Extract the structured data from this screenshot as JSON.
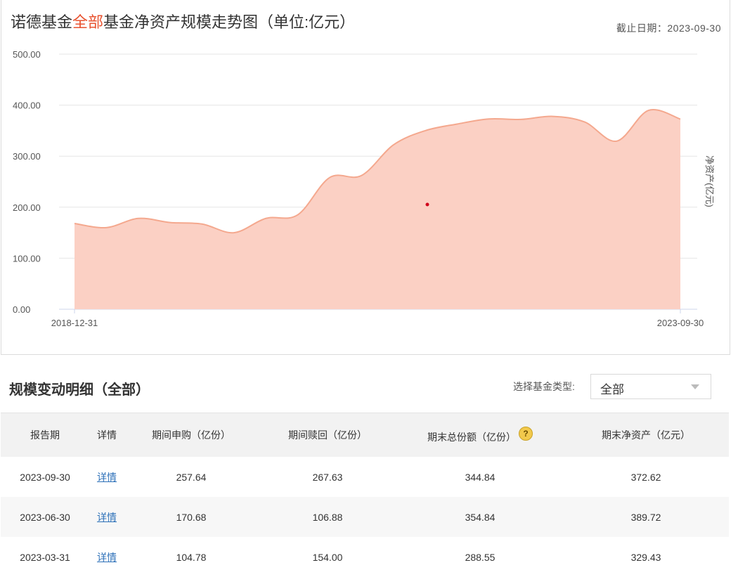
{
  "chart_header": {
    "title_prefix": "诺德基金",
    "title_highlight": "全部",
    "title_suffix": "基金净资产规模走势图（单位:亿元）",
    "as_of": "截止日期：2023-09-30"
  },
  "chart_data": {
    "type": "area",
    "ylabel": "净资产(亿元)",
    "ylim": [
      0,
      500
    ],
    "yticks": [
      "0.00",
      "100.00",
      "200.00",
      "300.00",
      "400.00",
      "500.00"
    ],
    "x_ticks": [
      "2018-12-31",
      "2023-09-30"
    ],
    "x": [
      "2018-12-31",
      "2019-03-31",
      "2019-06-30",
      "2019-09-30",
      "2019-12-31",
      "2020-03-31",
      "2020-06-30",
      "2020-09-30",
      "2020-12-31",
      "2021-03-31",
      "2021-06-30",
      "2021-09-30",
      "2021-12-31",
      "2022-03-31",
      "2022-06-30",
      "2022-09-30",
      "2022-12-31",
      "2023-03-31",
      "2023-06-30",
      "2023-09-30"
    ],
    "values": [
      168,
      160,
      178,
      170,
      167,
      150,
      178,
      185,
      258,
      262,
      322,
      350,
      363,
      373,
      372,
      378,
      367,
      329.43,
      389.72,
      372.62
    ],
    "grid": true,
    "fill_color": "#fbd0c4",
    "line_color": "#f4a88e"
  },
  "detail": {
    "section_title": "规模变动明细（全部）",
    "fund_type_label": "选择基金类型:",
    "fund_type_value": "全部",
    "headers": [
      "报告期",
      "详情",
      "期间申购（亿份）",
      "期间赎回（亿份）",
      "期末总份额（亿份）",
      "期末净资产（亿元）"
    ],
    "rows": [
      {
        "date": "2023-09-30",
        "detail": "详情",
        "purchase": "257.64",
        "redeem": "267.63",
        "shares": "344.84",
        "nav": "372.62"
      },
      {
        "date": "2023-06-30",
        "detail": "详情",
        "purchase": "170.68",
        "redeem": "106.88",
        "shares": "354.84",
        "nav": "389.72"
      },
      {
        "date": "2023-03-31",
        "detail": "详情",
        "purchase": "104.78",
        "redeem": "154.00",
        "shares": "288.55",
        "nav": "329.43"
      }
    ]
  },
  "colors": {
    "accent": "#e8522f",
    "link": "#2f72b9"
  },
  "icons": {
    "help": "question-help-icon"
  }
}
